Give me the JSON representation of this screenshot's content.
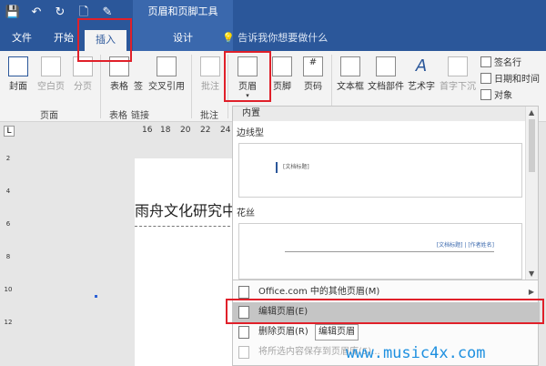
{
  "colors": {
    "accent": "#2b579a",
    "highlight": "#e0202a",
    "watermark": "#1e90e0"
  },
  "titlebar": {
    "qat": [
      {
        "name": "save-icon",
        "glyph": "💾"
      },
      {
        "name": "undo-icon",
        "glyph": "↶"
      },
      {
        "name": "redo-icon",
        "glyph": "↻"
      },
      {
        "name": "print-preview-icon",
        "glyph": "🗋"
      },
      {
        "name": "customize-qat-icon",
        "glyph": "✎"
      }
    ],
    "context_title": "页眉和页脚工具"
  },
  "tabs": [
    {
      "label": "文件",
      "active": false
    },
    {
      "label": "开始",
      "active": false
    },
    {
      "label": "插入",
      "active": true
    },
    {
      "label": "设计",
      "active": false
    }
  ],
  "tell_me": "告诉我你想要做什么",
  "ribbon": {
    "buttons": [
      {
        "name": "cover-page-button",
        "label": "封面",
        "dim": false
      },
      {
        "name": "blank-page-button",
        "label": "空白页",
        "dim": true
      },
      {
        "name": "page-break-button",
        "label": "分页",
        "dim": true
      },
      {
        "name": "table-button",
        "label": "表格",
        "dim": false
      },
      {
        "name": "bookmark-button",
        "label": "签",
        "dim": false
      },
      {
        "name": "cross-reference-button",
        "label": "交叉引用",
        "dim": false
      },
      {
        "name": "comment-button",
        "label": "批注",
        "dim": true
      },
      {
        "name": "header-button",
        "label": "页眉",
        "dim": false
      },
      {
        "name": "footer-button",
        "label": "页脚",
        "dim": false
      },
      {
        "name": "page-number-button",
        "label": "页码",
        "dim": false
      },
      {
        "name": "textbox-button",
        "label": "文本框",
        "dim": false
      },
      {
        "name": "quick-parts-button",
        "label": "文档部件",
        "dim": false
      },
      {
        "name": "wordart-button",
        "label": "艺术字",
        "dim": false
      },
      {
        "name": "dropcap-button",
        "label": "首字下沉",
        "dim": true
      }
    ],
    "small_buttons": [
      {
        "name": "signature-line-button",
        "label": "签名行"
      },
      {
        "name": "date-time-button",
        "label": "日期和时间"
      },
      {
        "name": "object-button",
        "label": "对象"
      }
    ],
    "groups": [
      "页面",
      "表格",
      "链接",
      "批注"
    ]
  },
  "ruler": {
    "h_numbers": [
      "16",
      "18",
      "20",
      "22",
      "24"
    ],
    "corner": "L",
    "v_numbers": [
      "2",
      "4",
      "6",
      "8",
      "10",
      "12"
    ]
  },
  "document": {
    "text": "雨舟文化研究中心"
  },
  "gallery": {
    "header": "内置",
    "template1_label": "边线型",
    "template1_text": "[文档标题]",
    "template2_label": "花丝",
    "template2_text": "[文档标题] | [作者姓名]"
  },
  "menu": [
    {
      "label": "Office.com 中的其他页眉(M)",
      "selected": false,
      "disabled": false,
      "submenu": true
    },
    {
      "label": "编辑页眉(E)",
      "selected": true,
      "disabled": false,
      "submenu": false
    },
    {
      "label": "删除页眉(R)",
      "selected": false,
      "disabled": false,
      "submenu": false
    },
    {
      "label": "将所选内容保存到页眉库(S)...",
      "selected": false,
      "disabled": true,
      "submenu": false
    }
  ],
  "tooltip": "编辑页眉",
  "watermark": "www.music4x.com"
}
